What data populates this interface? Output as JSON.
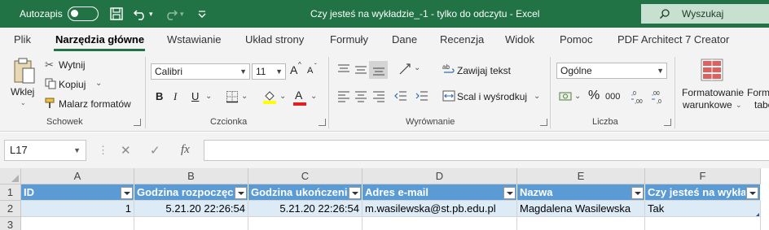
{
  "titlebar": {
    "autosave_label": "Autozapis",
    "document_title": "Czy jesteś na wykładzie_-1  -  tylko do odczytu  -  Excel",
    "search_label": "Wyszukaj"
  },
  "tabs": [
    "Plik",
    "Narzędzia główne",
    "Wstawianie",
    "Układ strony",
    "Formuły",
    "Dane",
    "Recenzja",
    "Widok",
    "Pomoc",
    "PDF Architect 7 Creator"
  ],
  "ribbon": {
    "clipboard": {
      "paste": "Wklej",
      "cut": "Wytnij",
      "copy": "Kopiuj",
      "format_painter": "Malarz formatów",
      "group_title": "Schowek"
    },
    "font": {
      "font_name": "Calibri",
      "font_size": "11",
      "bold": "B",
      "italic": "I",
      "underline": "U",
      "grow": "A",
      "shrink": "A",
      "font_color_letter": "A",
      "group_title": "Czcionka"
    },
    "alignment": {
      "wrap_text": "Zawijaj tekst",
      "merge_center": "Scal i wyśrodkuj",
      "group_title": "Wyrównanie"
    },
    "number": {
      "format": "Ogólne",
      "percent": "%",
      "thousands": "000",
      "group_title": "Liczba"
    },
    "styles": {
      "conditional_line1": "Formatowanie",
      "conditional_line2": "warunkowe",
      "format_table_line1": "Formatuj",
      "format_table_line2": "tabelę"
    }
  },
  "formula_bar": {
    "name_box": "L17",
    "fx": "fx",
    "formula": ""
  },
  "grid": {
    "columns": [
      "A",
      "B",
      "C",
      "D",
      "E",
      "F"
    ],
    "rows": [
      "1",
      "2",
      "3"
    ],
    "header_row": [
      "ID",
      "Godzina rozpoczęcia",
      "Godzina ukończenia",
      "Adres e-mail",
      "Nazwa",
      "Czy jesteś na wykładzie"
    ],
    "data_row": [
      "1",
      "5.21.20 22:26:54",
      "5.21.20 22:26:54",
      "m.wasilewska@st.pb.edu.pl",
      "Magdalena Wasilewska",
      "Tak"
    ]
  },
  "colors": {
    "excel_green": "#217346",
    "table_header_blue": "#5b9bd5",
    "table_row_blue": "#ddebf7"
  }
}
